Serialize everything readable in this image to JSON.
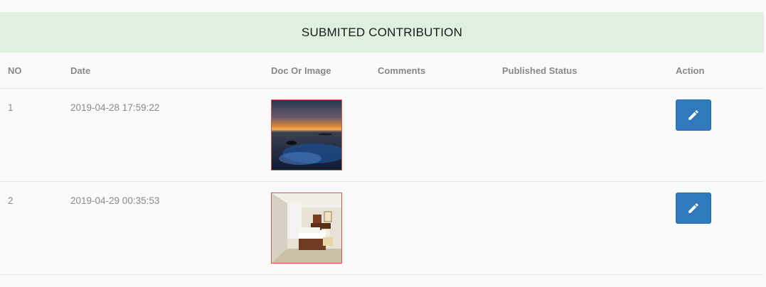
{
  "panel": {
    "title": "SUBMITED CONTRIBUTION"
  },
  "table": {
    "headers": [
      "NO",
      "Date",
      "Doc Or Image",
      "Comments",
      "Published Status",
      "Action"
    ],
    "rows": [
      {
        "no": "1",
        "date": "2019-04-28 17:59:22",
        "image": "seaside-sunset-thumbnail",
        "comments": "",
        "published_status": "",
        "action_icon": "pencil-icon"
      },
      {
        "no": "2",
        "date": "2019-04-29 00:35:53",
        "image": "bedroom-thumbnail",
        "comments": "",
        "published_status": "",
        "action_icon": "pencil-icon"
      }
    ]
  },
  "colors": {
    "header_bg": "#dff0e0",
    "button_bg": "#3079bd",
    "thumb_border": "#d9534f"
  }
}
